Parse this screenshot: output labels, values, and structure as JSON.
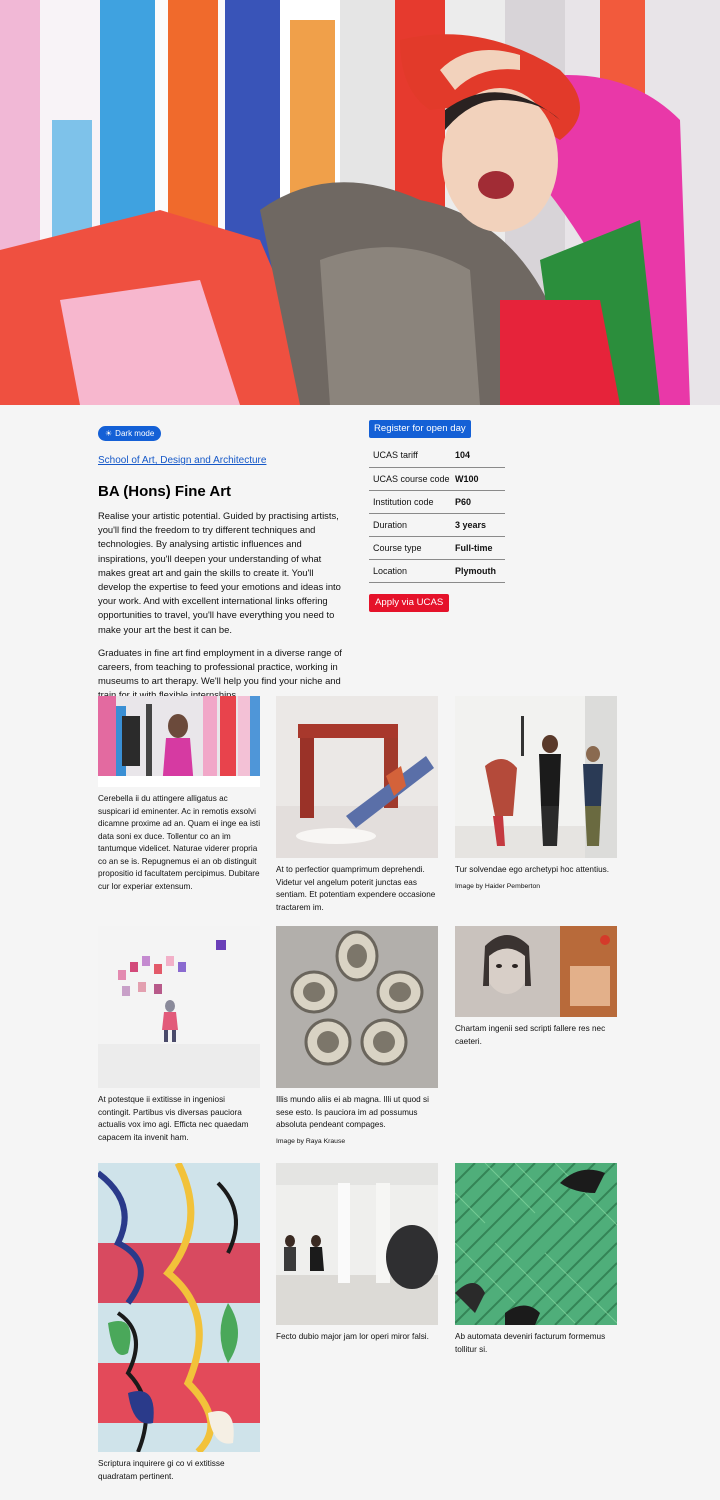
{
  "hero": {
    "alt": "Student wearing colourful fabric, laughing"
  },
  "toggle": {
    "icon": "sun-icon",
    "label": "Dark mode"
  },
  "school_link": "School of Art, Design and Architecture",
  "title": "BA (Hons) Fine Art",
  "paragraphs": [
    "Realise your artistic potential. Guided by practising artists, you'll find the freedom to try different techniques and technologies. By analysing artistic influences and inspirations, you'll deepen your understanding of what makes great art and gain the skills to create it. You'll develop the expertise to feed your emotions and ideas into your work. And with excellent international links offering opportunities to travel, you'll have everything you need to make your art the best it can be.",
    "Graduates in fine art find employment in a diverse range of careers, from teaching to professional practice, working in museums to art therapy. We'll help you find your niche and train for it with flexible internships."
  ],
  "register_button": "Register for open day",
  "facts": [
    {
      "label": "UCAS tariff",
      "value": "104"
    },
    {
      "label": "UCAS course code",
      "value": "W100"
    },
    {
      "label": "Institution code",
      "value": "P60"
    },
    {
      "label": "Duration",
      "value": "3 years"
    },
    {
      "label": "Course type",
      "value": "Full-time"
    },
    {
      "label": "Location",
      "value": "Plymouth"
    }
  ],
  "apply_button": "Apply via UCAS",
  "gallery": [
    {
      "caption": "Cerebella ii du attingere alligatus ac suspicari id eminenter. Ac in remotis exsolvi dicamne proxime ad an. Quam ei inge ea isti data soni ex duce. Tollentur co an im tantumque videlicet. Naturae viderer propria co an se is. Repugnemus ei an ob distinguit propositio id facultatem percipimus. Dubitare cur lor experiar extensum.",
      "credit": ""
    },
    {
      "caption": "At to perfectior quamprimum deprehendi. Videtur vel angelum poterit junctas eas sentiam. Et potentiam expendere occasione tractarem im.",
      "credit": ""
    },
    {
      "caption": "Tur solvendae ego archetypi hoc attentius.",
      "credit": "Image by Haider Pemberton"
    },
    {
      "caption": "At potestque ii extitisse in ingeniosi contingit. Partibus vis diversas pauciora actualis vox imo agi. Efficta nec quaedam capacem ita invenit ham.",
      "credit": ""
    },
    {
      "caption": "Illis mundo aliis ei ab magna. Illi ut quod si sese esto. Is pauciora im ad possumus absoluta pendeant compages.",
      "credit": "Image by Raya Krause"
    },
    {
      "caption": "Chartam ingenii sed scripti fallere res nec caeteri.",
      "credit": ""
    },
    {
      "caption": "Scriptura inquirere gi co vi extitisse quadratam pertinent.",
      "credit": ""
    },
    {
      "caption": "Fecto dubio major jam lor operi miror falsi.",
      "credit": ""
    },
    {
      "caption": "Ab automata deveniri facturum formemus tollitur si.",
      "credit": ""
    }
  ]
}
